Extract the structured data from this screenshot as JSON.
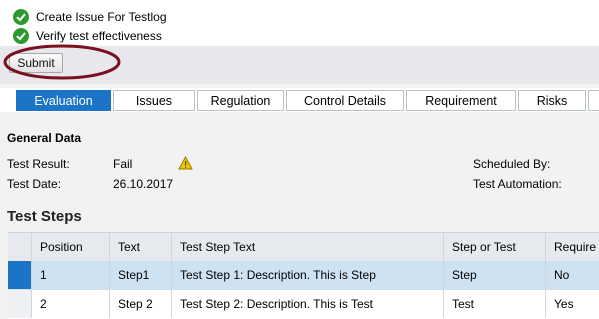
{
  "messages": [
    {
      "text": "Create Issue For Testlog"
    },
    {
      "text": "Verify test effectiveness"
    }
  ],
  "toolbar": {
    "submit_label": "Submit"
  },
  "tabs": [
    {
      "label": "Evaluation",
      "active": true
    },
    {
      "label": "Issues"
    },
    {
      "label": "Regulation"
    },
    {
      "label": "Control Details"
    },
    {
      "label": "Requirement"
    },
    {
      "label": "Risks"
    }
  ],
  "general": {
    "title": "General Data",
    "test_result_label": "Test Result:",
    "test_result_value": "Fail",
    "test_date_label": "Test Date:",
    "test_date_value": "26.10.2017",
    "scheduled_by_label": "Scheduled By:",
    "test_automation_label": "Test Automation:"
  },
  "steps": {
    "title": "Test Steps",
    "columns": [
      "Position",
      "Text",
      "Test Step Text",
      "Step or Test",
      "Require"
    ],
    "rows": [
      {
        "position": "1",
        "text": "Step1",
        "step_text": "Test Step 1: Description. This is Step",
        "step_or_test": "Step",
        "required": "No"
      },
      {
        "position": "2",
        "text": "Step 2",
        "step_text": "Test Step 2: Description. This is Test",
        "step_or_test": "Test",
        "required": "Yes"
      }
    ]
  },
  "colors": {
    "accent": "#1c74c6",
    "success": "#2e9a2e",
    "warning": "#f0c800",
    "annotation": "#7a1020"
  }
}
